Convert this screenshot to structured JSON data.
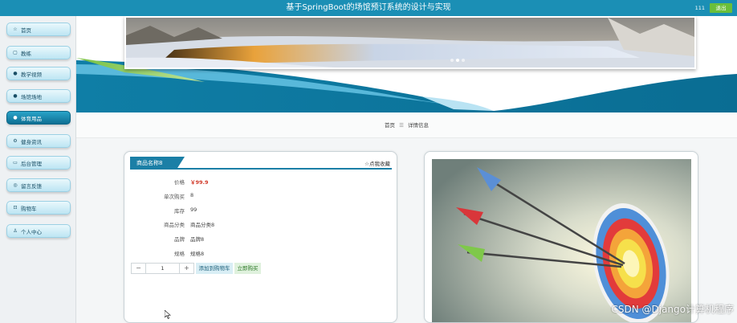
{
  "header": {
    "title": "基于SpringBoot的场馆预订系统的设计与实现",
    "user": "111",
    "logout_label": "退出"
  },
  "sidebar": {
    "items": [
      {
        "label": "首页",
        "icon": "star-icon",
        "glyph": "☆",
        "active": false
      },
      {
        "label": "教练",
        "icon": "calendar-icon",
        "glyph": "▢",
        "active": false
      },
      {
        "label": "教学视频",
        "icon": "dot-icon",
        "glyph": "●",
        "active": false
      },
      {
        "label": "场馆场地",
        "icon": "help-icon",
        "glyph": "●",
        "active": false
      },
      {
        "label": "体育用品",
        "icon": "info-icon",
        "glyph": "●",
        "active": true
      },
      {
        "label": "健身资讯",
        "icon": "settings-icon",
        "glyph": "⚙",
        "active": false
      },
      {
        "label": "后台管理",
        "icon": "monitor-icon",
        "glyph": "▭",
        "active": false
      },
      {
        "label": "留言反馈",
        "icon": "feedback-icon",
        "glyph": "◎",
        "active": false
      },
      {
        "label": "购物车",
        "icon": "cart-icon",
        "glyph": "⊡",
        "active": false
      },
      {
        "label": "个人中心",
        "icon": "user-icon",
        "glyph": "♙",
        "active": false
      }
    ]
  },
  "breadcrumb": {
    "home": "首页",
    "separator": "☰",
    "current": "详情信息"
  },
  "carousel": {
    "dot_count": 3,
    "active_index": 1
  },
  "product": {
    "name": "商品名称8",
    "favorite_label": "☆点我收藏",
    "fields": [
      {
        "key": "价格",
        "value": "￥99.9",
        "is_price": true
      },
      {
        "key": "单次购买",
        "value": "8",
        "is_price": false
      },
      {
        "key": "库存",
        "value": "99",
        "is_price": false
      },
      {
        "key": "商品分类",
        "value": "商品分类8",
        "is_price": false
      },
      {
        "key": "品牌",
        "value": "品牌8",
        "is_price": false
      },
      {
        "key": "规格",
        "value": "规格8",
        "is_price": false
      }
    ],
    "quantity": "1",
    "minus_label": "−",
    "plus_label": "+",
    "add_cart_label": "添加到购物车",
    "buy_label": "立即购买"
  },
  "colors": {
    "header": "#1b8fb5",
    "accent": "#1b7fa6",
    "logout": "#6abf3a",
    "price": "#d13a2a"
  },
  "watermark": "CSDN @Django计算机程序"
}
